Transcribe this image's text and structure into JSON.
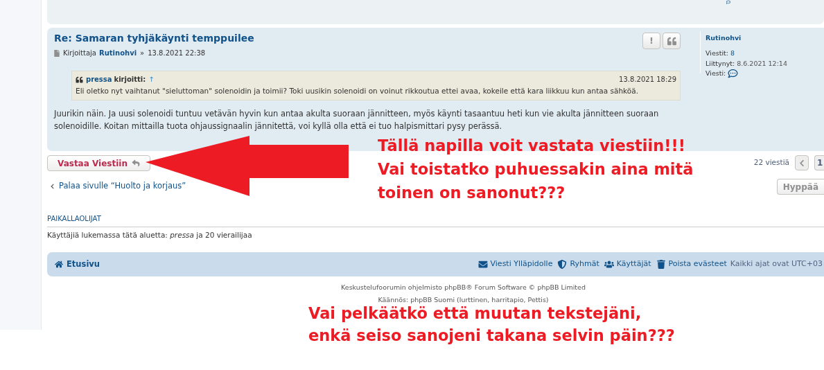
{
  "post": {
    "title": "Re: Samaran tyhjäkäynti temppuilee",
    "author_prefix": "Kirjoittaja",
    "author": "Rutinohvi",
    "separator": "»",
    "date": "13.8.2021 22:38",
    "actions": [
      {
        "kind": "report",
        "label": "!"
      },
      {
        "kind": "quote"
      }
    ],
    "quote": {
      "author": "pressa",
      "verb": "kirjoitti:",
      "jump": "↑",
      "date": "13.8.2021 18:29",
      "text": "Eli oletko nyt vaihtanut \"sieluttoman\" solenoidin ja toimii? Toki uusikin solenoidi on voinut rikkoutua ettei avaa, kokeile että kara liikkuu kun antaa sähköä."
    },
    "body": "Juurikin näin. Ja uusi solenoidi tuntuu vetävän hyvin kun antaa akulta suoraan jännitteen, myös käynti tasaantuu heti kun vie akulta jännitteen suoraan solenoidille. Koitan mittailla tuota ohjaussignaalin jännitettä, voi kyllä olla että ei tuo halpismittari pysy perässä.",
    "profile": {
      "name": "Rutinohvi",
      "stats": [
        {
          "label": "Viestit:",
          "value": "8"
        },
        {
          "label": "Liittynyt:",
          "value": "8.6.2021 12:14"
        },
        {
          "label": "Viesti:"
        }
      ]
    }
  },
  "reply_button": "Vastaa Viestiin",
  "post_count": "22 viestiä",
  "page_button": "1",
  "jump_button": "Hyppää",
  "back_link": "Palaa sivulle “Huolto ja korjaus”",
  "online": {
    "heading": "PAIKALLAOLIJAT",
    "text": "Käyttäjiä lukemassa tätä aluetta: *pressa* ja 20 vierailijaa"
  },
  "navbar": {
    "home": "Etusivu",
    "links": [
      {
        "kind": "mail",
        "label": "Viesti Ylläpidolle"
      },
      {
        "kind": "shield",
        "label": "Ryhmät"
      },
      {
        "kind": "users",
        "label": "Käyttäjät"
      },
      {
        "kind": "trash",
        "label": "Poista evästeet"
      }
    ],
    "timezone": "Kaikki ajat ovat UTC+03"
  },
  "footer": [
    "Keskustelufoorumin ohjelmisto phpBB® Forum Software © phpBB Limited",
    "Käännös: phpBB Suomi (lurttinen, harritapio, Pettis)"
  ],
  "annotations": [
    {
      "lines": [
        "Tällä napilla voit vastata viestiin!!!",
        "Vai toistatko puhuessakin aina mitä",
        "toinen on sanonut???"
      ]
    },
    {
      "lines": [
        "Vai pelkäätkö että muutan tekstejäni,",
        "enkä seiso sanojeni takana selvin päin???"
      ]
    }
  ]
}
